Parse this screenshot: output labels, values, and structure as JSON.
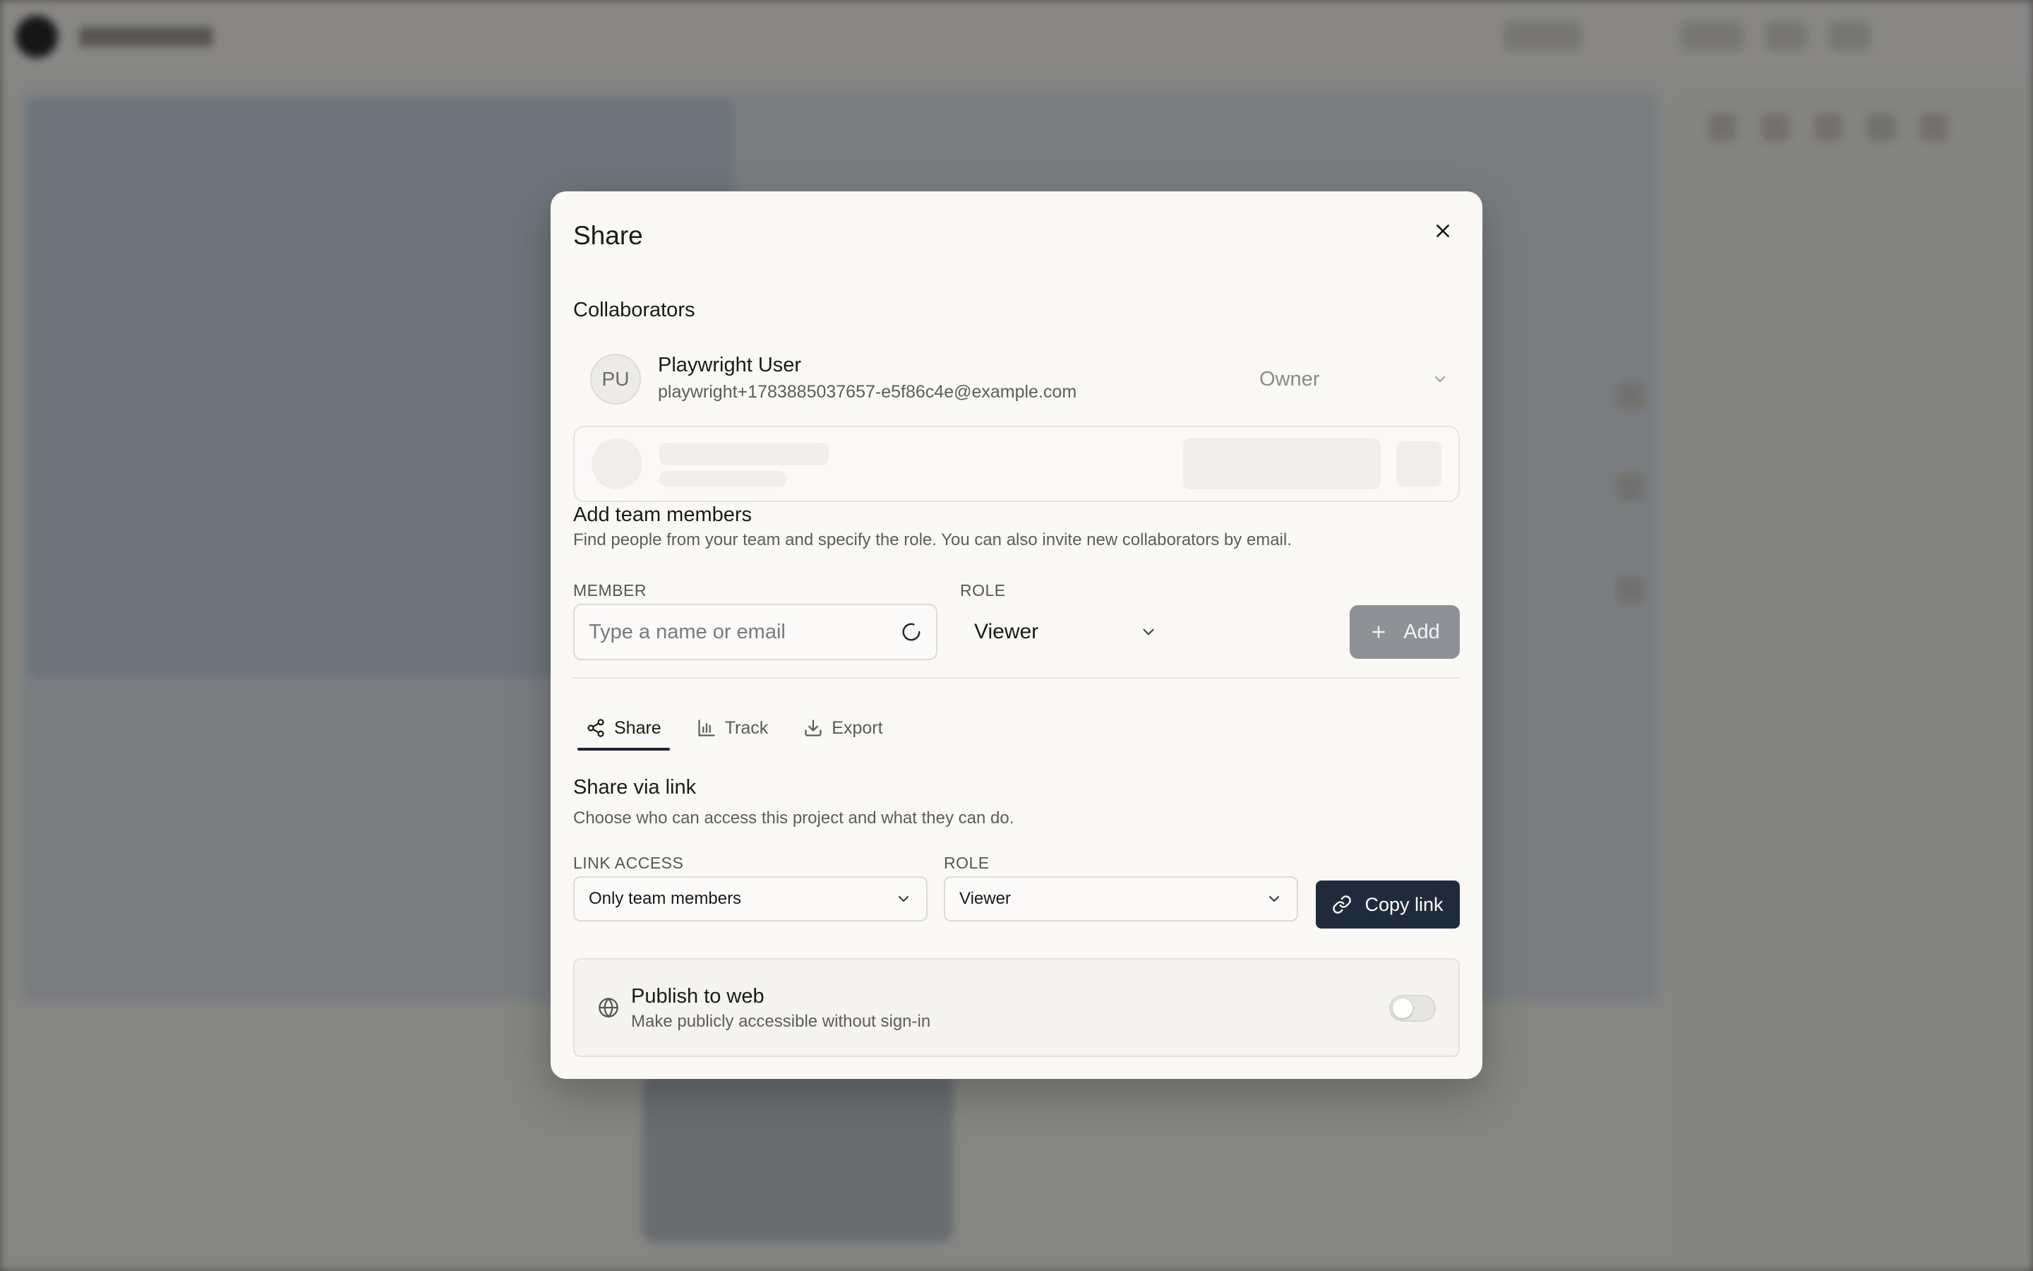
{
  "modal": {
    "title": "Share",
    "collaborators": {
      "heading": "Collaborators",
      "items": [
        {
          "initials": "PU",
          "name": "Playwright User",
          "email": "playwright+1783885037657-e5f86c4e@example.com",
          "role": "Owner"
        }
      ]
    },
    "add_members": {
      "heading": "Add team members",
      "description": "Find people from your team and specify the role. You can also invite new collaborators by email.",
      "member_label": "MEMBER",
      "member_placeholder": "Type a name or email",
      "member_value": "",
      "role_label": "ROLE",
      "role_value": "Viewer",
      "add_label": "Add"
    },
    "tabs": [
      {
        "label": "Share",
        "icon": "share-icon",
        "active": true
      },
      {
        "label": "Track",
        "icon": "bar-chart-icon",
        "active": false
      },
      {
        "label": "Export",
        "icon": "download-icon",
        "active": false
      }
    ],
    "share_link": {
      "heading": "Share via link",
      "description": "Choose who can access this project and what they can do.",
      "link_access_label": "LINK ACCESS",
      "link_access_value": "Only team members",
      "role_label": "ROLE",
      "role_value": "Viewer",
      "copy_label": "Copy link"
    },
    "publish": {
      "title": "Publish to web",
      "subtitle": "Make publicly accessible without sign-in",
      "enabled": false
    }
  },
  "colors": {
    "primary_button": "#1f2a3d",
    "disabled_button": "#8e9297",
    "modal_bg": "#f9f8f5"
  }
}
